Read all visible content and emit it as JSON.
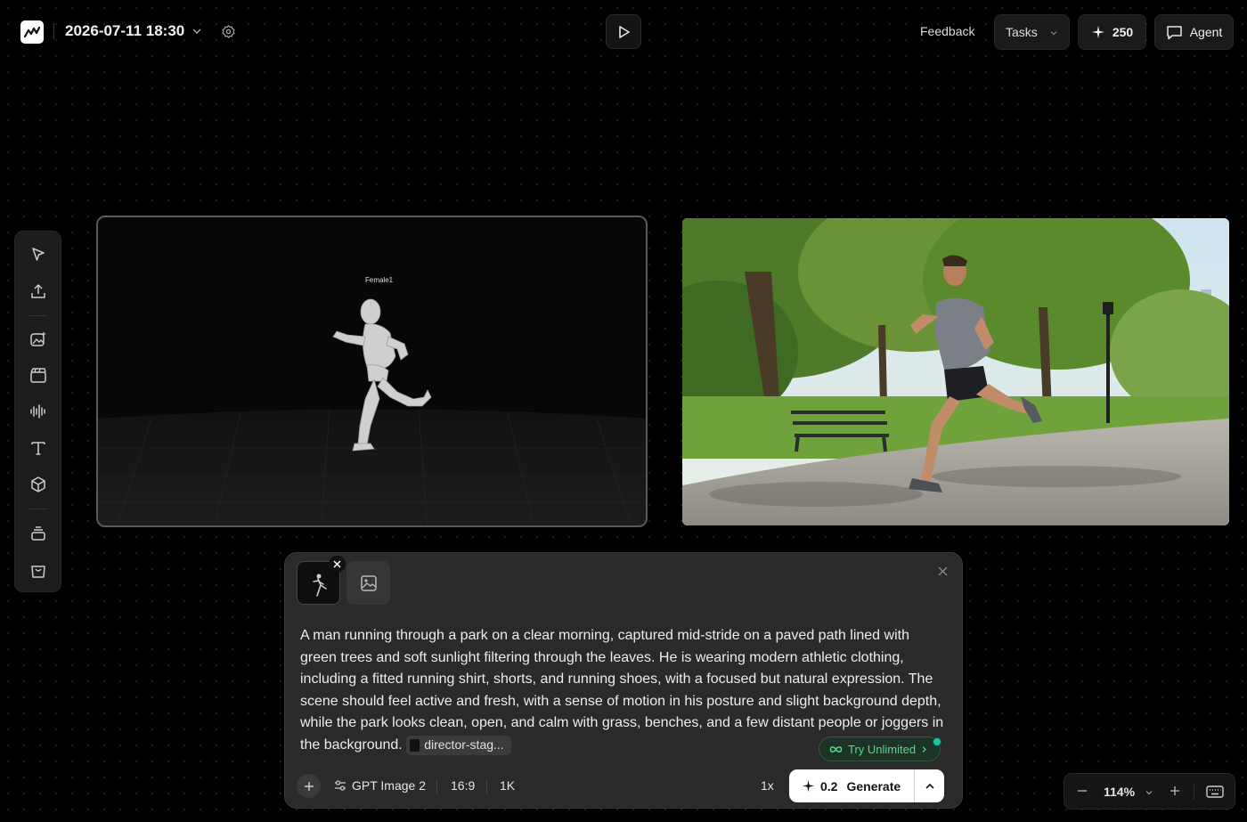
{
  "header": {
    "project_title": "2026-07-11 18:30",
    "feedback_label": "Feedback",
    "tasks_label": "Tasks",
    "credits": "250",
    "agent_label": "Agent"
  },
  "toolbar": {
    "tools": [
      "select-icon",
      "upload-icon",
      "image-generate-icon",
      "video-icon",
      "audio-waveform-icon",
      "text-icon",
      "3d-cube-icon",
      "layers-icon",
      "bag-icon"
    ]
  },
  "canvas": {
    "left_frame_label": "Female1"
  },
  "prompt_panel": {
    "prompt_text": "A man running through a park on a clear morning, captured mid-stride on a paved path lined with green trees and soft sunlight filtering through the leaves. He is wearing modern athletic clothing, including a fitted running shirt, shorts, and running shoes, with a focused but natural expression. The scene should feel active and fresh, with a sense of motion in his posture and slight background depth, while the park looks clean, open, and calm with grass, benches, and a few distant people or joggers in the background.",
    "reference_chip": "director-stag...",
    "try_unlimited": "Try Unlimited",
    "model": "GPT Image 2",
    "aspect_ratio": "16:9",
    "resolution": "1K",
    "multiplier": "1x",
    "cost": "0.2",
    "generate_label": "Generate"
  },
  "zoom": {
    "value": "114%"
  },
  "colors": {
    "background": "#000000",
    "panel": "#2a2a2a",
    "accent_green": "#59d98a",
    "status_dot": "#1fc4a8"
  }
}
